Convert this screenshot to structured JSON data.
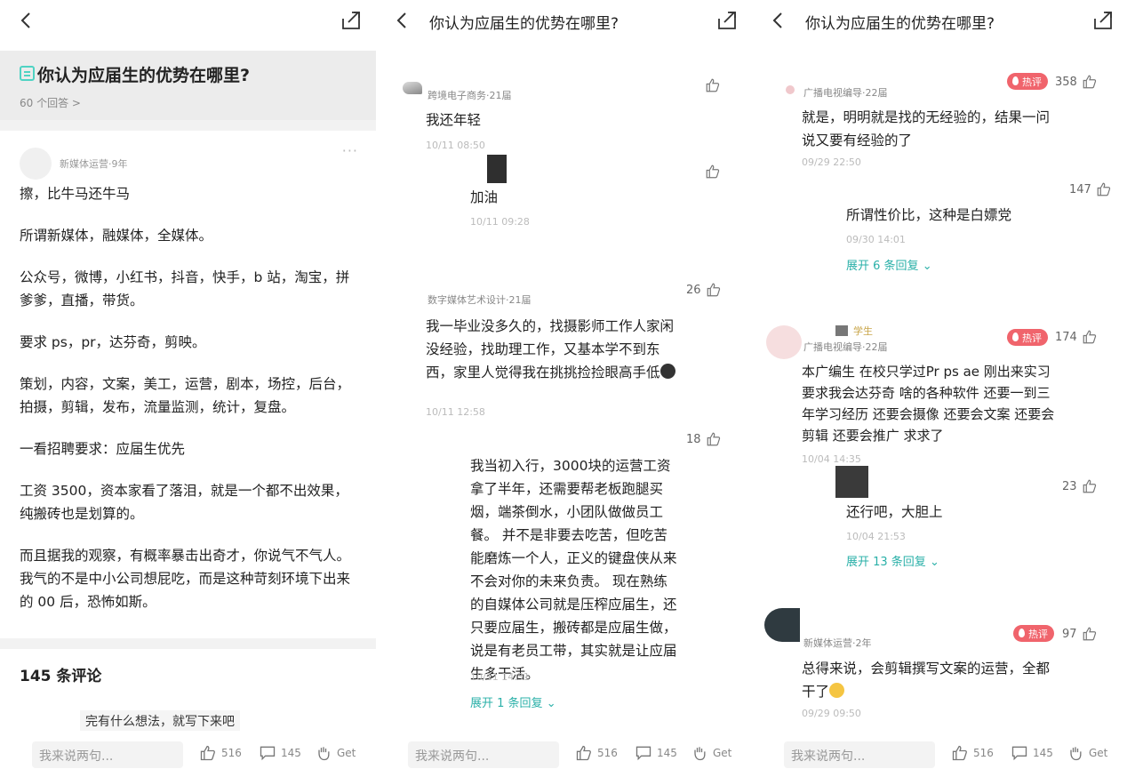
{
  "question": {
    "title": "你认为应届生的优势在哪里?",
    "answer_count": "60 个回答 >"
  },
  "bottombar": {
    "input_placeholder": "我来说两句...",
    "like_count": "516",
    "comment_count": "145",
    "get_label": "Get"
  },
  "panel1": {
    "author": "新媒体运营·9年",
    "more": "···",
    "paragraphs": [
      "擦，比牛马还牛马",
      "所谓新媒体，融媒体，全媒体。",
      "公众号，微博，小红书，抖音，快手，b 站，淘宝，拼爹爹，直播，带货。",
      "要求 ps，pr，达芬奇，剪映。",
      "策划，内容，文案，美工，运营，剧本，场控，后台，拍摄，剪辑，发布，流量监测，统计，复盘。",
      "一看招聘要求：应届生优先",
      "工资 3500，资本家看了落泪，就是一个都不出效果，纯搬砖也是划算的。",
      "而且据我的观察，有概率暴击出奇才，你说气不气人。我气的不是中小公司想屁吃，而是这种苛刻环境下出来的 00 后，恐怖如斯。"
    ],
    "comments_heading": "145 条评论",
    "comment_prompt": "完有什么想法，就写下来吧"
  },
  "panel2": {
    "comments": [
      {
        "name": "跨境电子商务·21届",
        "text": "我还年轻",
        "time": "10/11 08:50",
        "likes": ""
      },
      {
        "name": "",
        "text": "加油",
        "time": "10/11 09:28",
        "likes": ""
      },
      {
        "name": "数字媒体艺术设计·21届",
        "text": "我一毕业没多久的，找摄影师工作人家闲没经验，找助理工作，又基本学不到东西，家里人觉得我在挑挑捡捡眼高手低",
        "time": "10/11 12:58",
        "likes": "26"
      },
      {
        "name": "",
        "text": "我当初入行，3000块的运营工资拿了半年，还需要帮老板跑腿买烟，端茶倒水，小团队做做员工餐。 并不是非要去吃苦，但吃苦能磨炼一个人，正义的键盘侠从来不会对你的未来负责。 现在熟练的自媒体公司就是压榨应届生，还只要应届生，搬砖都是应届生做，说是有老员工带，其实就是让应届生多干活。",
        "time": "10/11 14:31",
        "likes": "18"
      }
    ],
    "expand": "展开 1 条回复"
  },
  "panel3": {
    "hot_label": "热评",
    "comments": [
      {
        "name": "广播电视编导·22届",
        "text": "就是，明明就是找的无经验的，结果一问说又要有经验的了",
        "time": "09/29 22:50",
        "likes": "358"
      },
      {
        "name": "",
        "text": "所谓性价比，这种是白嫖党",
        "time": "09/30 14:01",
        "likes": "147"
      },
      {
        "name": "广播电视编导·22届",
        "badge": "学生",
        "text": "本广编生 在校只学过Pr ps ae 刚出来实习要求我会达芬奇 啥的各种软件 还要一到三年学习经历 还要会摄像 还要会文案 还要会剪辑 还要会推广 求求了",
        "time": "10/04 14:35",
        "likes": "174"
      },
      {
        "name": "",
        "text": "还行吧，大胆上",
        "time": "10/04 21:53",
        "likes": "23"
      },
      {
        "name": "新媒体运营·2年",
        "text": "总得来说，会剪辑撰写文案的运营，全都干了",
        "time": "09/29 09:50",
        "likes": "97"
      }
    ],
    "expand_a": "展开 6 条回复",
    "expand_b": "展开 13 条回复"
  }
}
